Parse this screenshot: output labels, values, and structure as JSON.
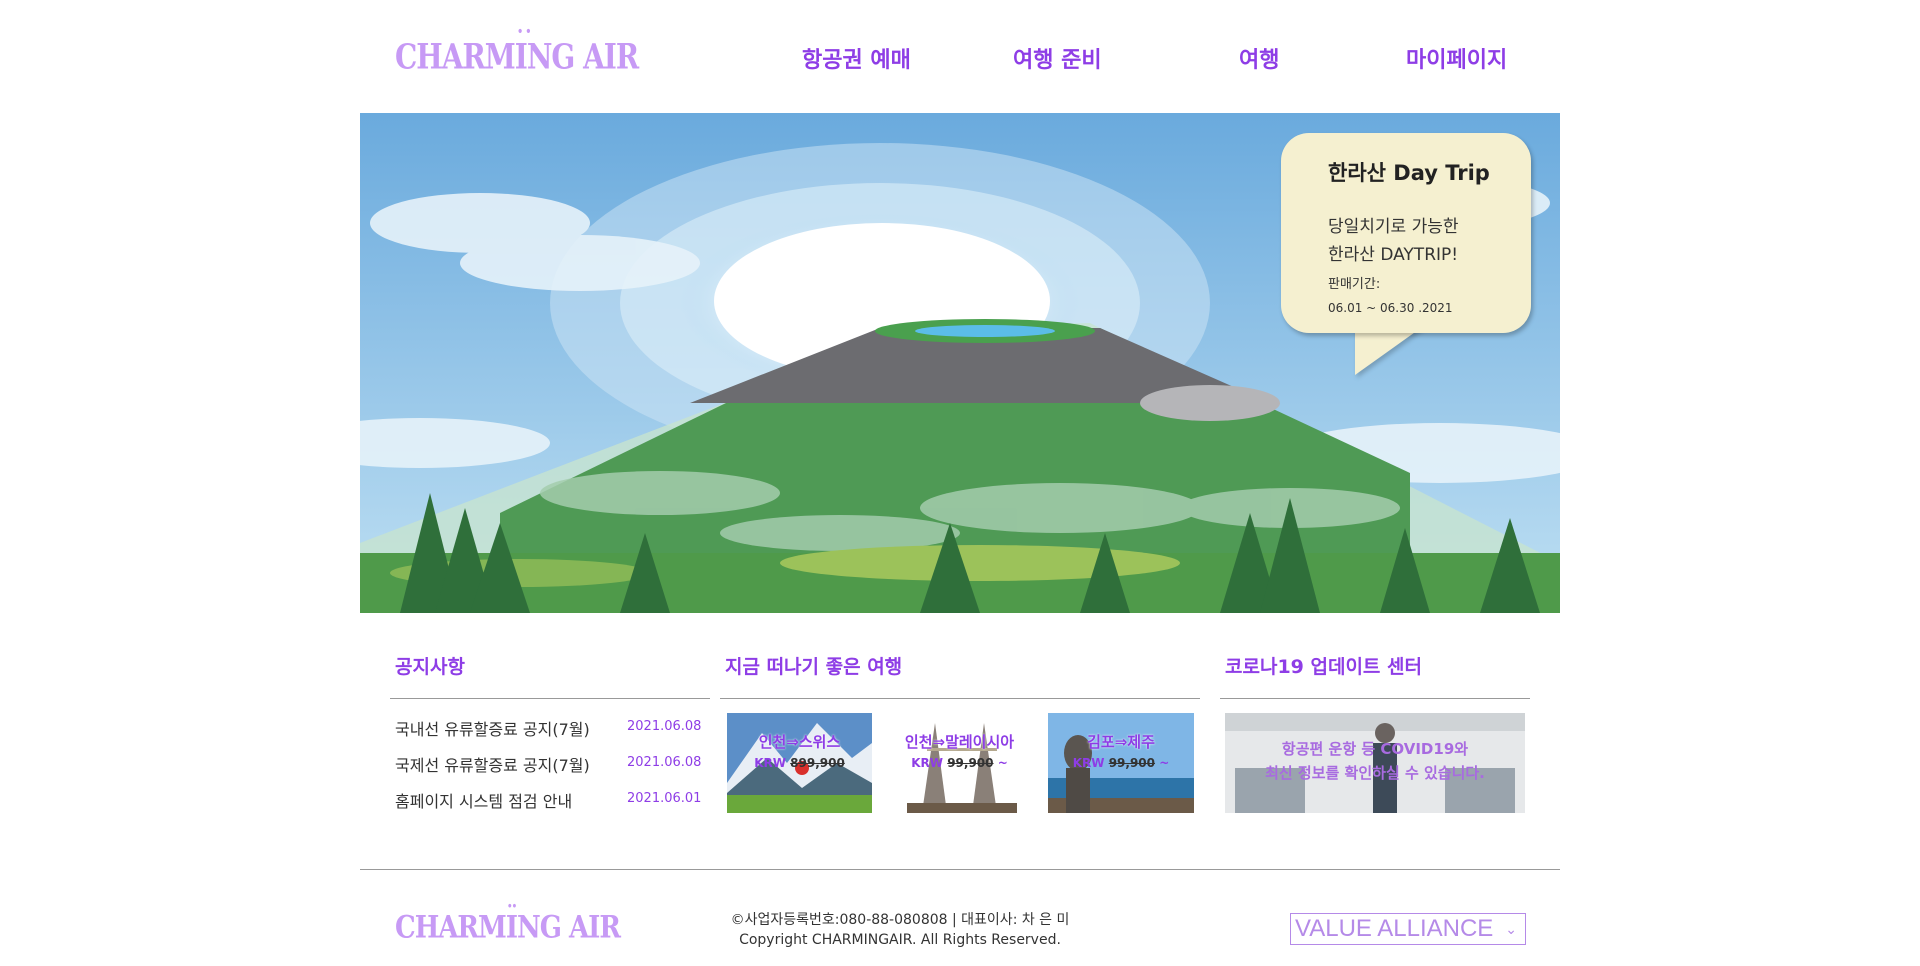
{
  "brand": {
    "logo": "CHARMING AIR",
    "logo_dots": "··"
  },
  "nav": [
    {
      "label": "항공권 예매"
    },
    {
      "label": "여행 준비"
    },
    {
      "label": "여행"
    },
    {
      "label": "마이페이지"
    }
  ],
  "promo": {
    "title": "한라산 Day Trip",
    "desc_line1": "당일치기로 가능한",
    "desc_line2": "한라산 DAYTRIP!",
    "period_label": "판매기간:",
    "period": "06.01 ~ 06.30 .2021"
  },
  "notice": {
    "title": "공지사항",
    "items": [
      {
        "text": "국내선 유류할증료 공지(7월)",
        "date": "2021.06.08"
      },
      {
        "text": "국제선 유류할증료 공지(7월)",
        "date": "2021.06.08"
      },
      {
        "text": "홈페이지 시스템 점검 안내",
        "date": "2021.06.01"
      }
    ]
  },
  "trips": {
    "title": "지금 떠나기 좋은 여행",
    "items": [
      {
        "route": "인천⇒스위스",
        "currency": "KRW",
        "price": "899,900"
      },
      {
        "route": "인천⇒말레이시아",
        "currency": "KRW",
        "price": "99,900",
        "suffix": "~"
      },
      {
        "route": "김포⇒제주",
        "currency": "KRW",
        "price": "99,900",
        "suffix": "~"
      }
    ]
  },
  "covid": {
    "title": "코로나19 업데이트 센터",
    "line1": "항공편 운항 등 COVID19와",
    "line2": "최신 정보를 확인하실 수 있습니다."
  },
  "footer": {
    "business": "©사업자등록번호:080-88-080808 | 대표이사: 차 은 미",
    "copyright": "Copyright CHARMINGAIR. All Rights Reserved.",
    "alliance_selected": "VALUE ALLIANCE"
  },
  "colors": {
    "accent": "#8e3de6",
    "logo": "#c79af5",
    "bubble": "#f5f0d0"
  }
}
